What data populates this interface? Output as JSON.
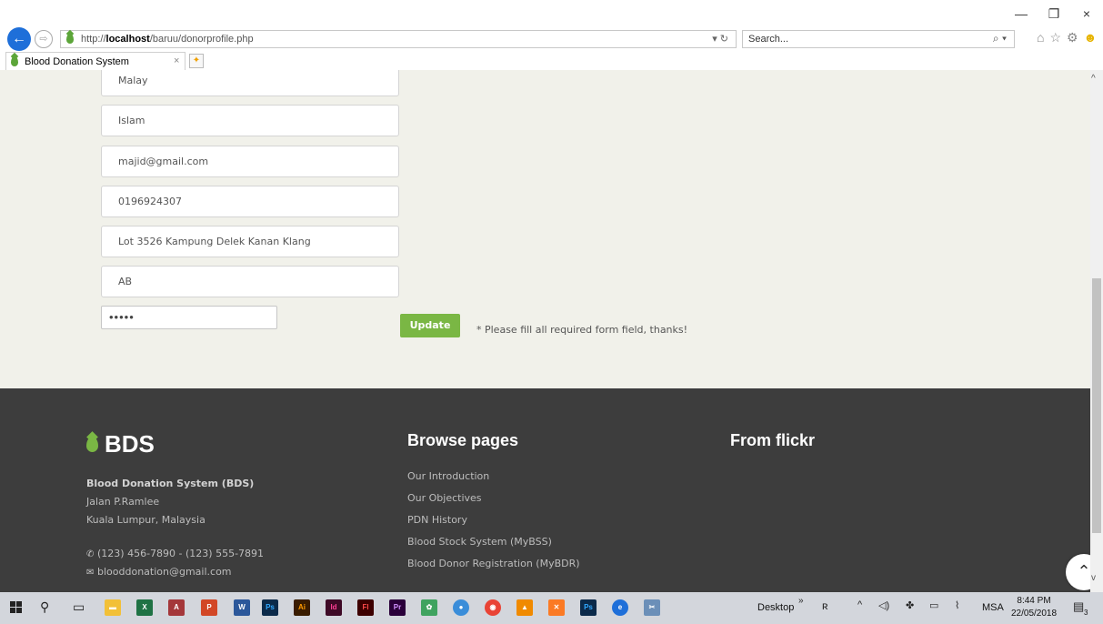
{
  "browser": {
    "url_prefix": "http://",
    "url_host": "localhost",
    "url_path": "/baruu/donorprofile.php",
    "search_placeholder": "Search...",
    "tab_title": "Blood Donation System",
    "tab_close": "×",
    "window_controls": [
      "—",
      "❐",
      "×"
    ]
  },
  "form": {
    "race": "Malay",
    "religion": "Islam",
    "email": "majid@gmail.com",
    "phone": "0196924307",
    "address": "Lot 3526 Kampung Delek Kanan Klang",
    "blood_type": "AB",
    "password_mask": "•••••",
    "update_label": "Update",
    "required_note": "* Please fill all required form field, thanks!"
  },
  "footer": {
    "logo_text": "BDS",
    "org_name": "Blood Donation System (BDS)",
    "address_line1": "Jalan P.Ramlee",
    "address_line2": "Kuala Lumpur, Malaysia",
    "phone": "(123) 456-7890 - (123) 555-7891",
    "email": "blooddonation@gmail.com",
    "browse_title": "Browse pages",
    "browse_links": [
      "Our Introduction",
      "Our Objectives",
      "PDN History",
      "Blood Stock System (MyBSS)",
      "Blood Donor Registration (MyBDR)"
    ],
    "flickr_title": "From flickr",
    "accent_color": "#7ab744",
    "background_color": "#3d3d3d"
  },
  "taskbar": {
    "desktop_label": "Desktop",
    "language": "MSA",
    "time": "8:44 PM",
    "date": "22/05/2018",
    "notification_count": "3",
    "app_icons": [
      "file-explorer",
      "excel",
      "access",
      "powerpoint",
      "word",
      "photoshop",
      "illustrator",
      "indesign",
      "flash",
      "premiere",
      "paint",
      "messenger",
      "chrome",
      "vlc",
      "xampp",
      "photoshop-2",
      "internet-explorer",
      "snipping-tool"
    ]
  }
}
